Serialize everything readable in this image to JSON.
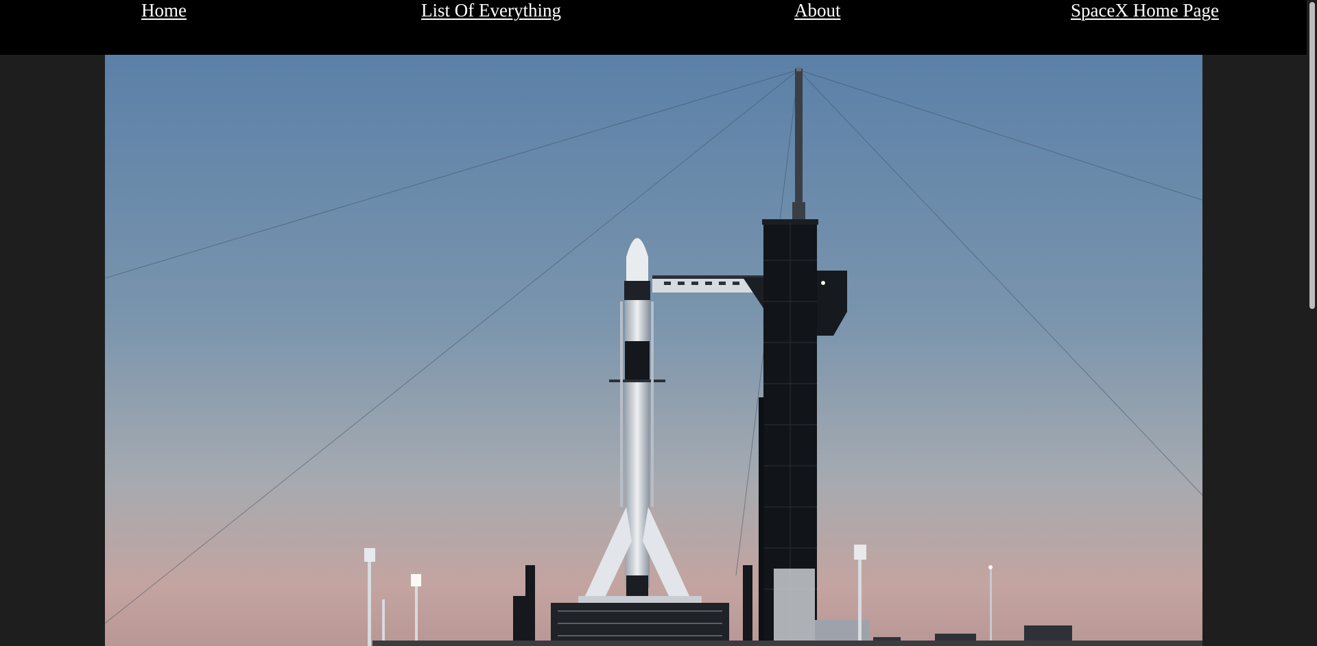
{
  "nav": {
    "items": [
      {
        "label": "Home"
      },
      {
        "label": "List Of Everything"
      },
      {
        "label": "About"
      },
      {
        "label": "SpaceX Home Page"
      }
    ]
  },
  "hero": {
    "icon": "rocket-launch-pad-photo"
  },
  "colors": {
    "nav_background": "#000000",
    "page_background": "#1e1e1e",
    "nav_text": "#ffffff",
    "sky_top": "#5a7ea6",
    "sky_bottom": "#c9a7a1"
  }
}
